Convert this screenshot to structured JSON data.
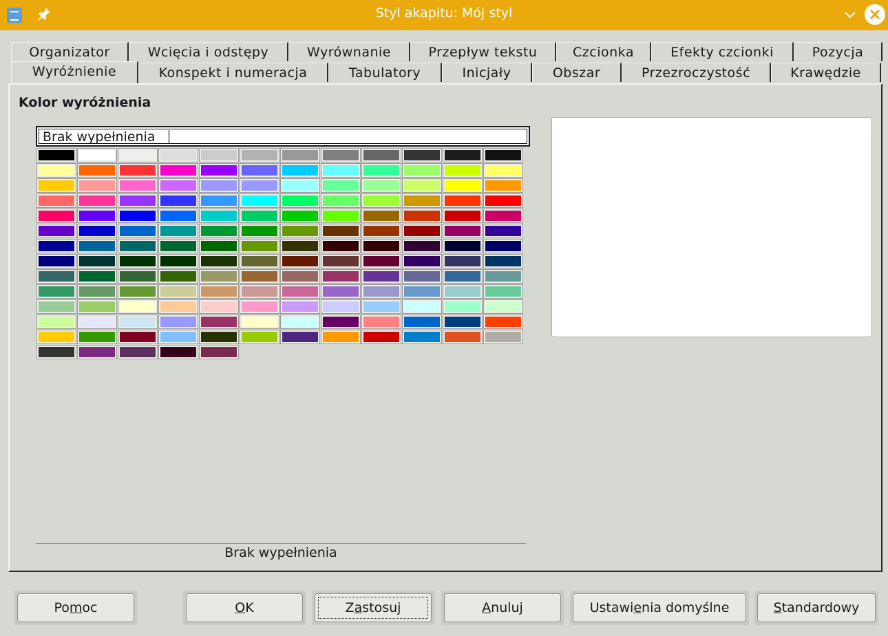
{
  "window": {
    "title": "Styl akapitu: Mój styl",
    "icons": {
      "app": "writer-style-icon",
      "pin": "pin-icon",
      "minimize": "chevron-down-icon",
      "close": "close-icon"
    },
    "accent": "#ebaa0c"
  },
  "tabs": {
    "row1": [
      {
        "label": "Organizator",
        "w": 171
      },
      {
        "label": "Wcięcia i odstępy",
        "w": 232
      },
      {
        "label": "Wyrównanie",
        "w": 177
      },
      {
        "label": "Przepływ tekstu",
        "w": 212
      },
      {
        "label": "Czcionka",
        "w": 138
      },
      {
        "label": "Efekty czcionki",
        "w": 207
      },
      {
        "label": "Pozycja",
        "w": 129
      }
    ],
    "row2": [
      {
        "label": "Wyróżnienie",
        "w": 185,
        "active": true
      },
      {
        "label": "Konspekt i numeracja",
        "w": 276
      },
      {
        "label": "Tabulatory",
        "w": 165
      },
      {
        "label": "Inicjały",
        "w": 131
      },
      {
        "label": "Obszar",
        "w": 130
      },
      {
        "label": "Przezroczystość",
        "w": 217
      },
      {
        "label": "Krawędzie",
        "w": 160
      }
    ]
  },
  "highlight": {
    "section_title": "Kolor wyróżnienia",
    "palette_header": "Brak wypełnienia",
    "selected_name": "Brak wypełnienia",
    "palette_colors": [
      "#000000",
      "#ffffff",
      "#eeeeee",
      "#dddddd",
      "#cccccc",
      "#b2b2b2",
      "#999999",
      "#808080",
      "#666666",
      "#333333",
      "#1c1c1c",
      "#111111",
      "#ffff99",
      "#ff6600",
      "#ff3333",
      "#ff00cc",
      "#9900ff",
      "#6666ff",
      "#00ccff",
      "#66ffff",
      "#33ff99",
      "#99ff66",
      "#ccff00",
      "#ffff66",
      "#ffcc00",
      "#ff9999",
      "#ff66cc",
      "#cc66ff",
      "#9999ff",
      "#9999ff",
      "#99ffff",
      "#66ff99",
      "#99ff99",
      "#ccff66",
      "#ffff00",
      "#ff9900",
      "#ff6666",
      "#ff3399",
      "#9933ff",
      "#3333ff",
      "#3399ff",
      "#00ffff",
      "#00ff66",
      "#66ff66",
      "#99ff33",
      "#cc9900",
      "#ff3300",
      "#ff0000",
      "#ff0066",
      "#6600ff",
      "#0000ff",
      "#0066ff",
      "#00cccc",
      "#00cc66",
      "#00cc00",
      "#66ff00",
      "#996600",
      "#cc3300",
      "#cc0000",
      "#cc0066",
      "#6600cc",
      "#0000cc",
      "#0066cc",
      "#009999",
      "#009933",
      "#009900",
      "#669900",
      "#663300",
      "#993300",
      "#990000",
      "#990066",
      "#330099",
      "#000099",
      "#006699",
      "#006666",
      "#006633",
      "#006600",
      "#669900",
      "#333300",
      "#330000",
      "#330000",
      "#330033",
      "#000033",
      "#000066",
      "#000080",
      "#003333",
      "#003300",
      "#003300",
      "#1a3300",
      "#666633",
      "#661a00",
      "#663333",
      "#660033",
      "#330066",
      "#333366",
      "#003366",
      "#336666",
      "#006633",
      "#336633",
      "#336600",
      "#999966",
      "#996633",
      "#996666",
      "#993366",
      "#663399",
      "#666699",
      "#336699",
      "#669999",
      "#339966",
      "#669966",
      "#669933",
      "#cccc99",
      "#cc9966",
      "#cc9999",
      "#cc6699",
      "#9966cc",
      "#9999cc",
      "#6699cc",
      "#99cccc",
      "#66cc99",
      "#99cc99",
      "#99cc66",
      "#ffffcc",
      "#ffcc99",
      "#ffcccc",
      "#ff99cc",
      "#cc99ff",
      "#ccccff",
      "#99ccff",
      "#ccffff",
      "#99ffcc",
      "#ccffcc",
      "#ccff99",
      "#e6e6ff",
      "#cce6f2",
      "#9999ff",
      "#993366",
      "#ffffcc",
      "#ccffff",
      "#660066",
      "#ff8080",
      "#0066cc",
      "#004080",
      "#ff4000",
      "#ffcc00",
      "#339900",
      "#800020",
      "#80c0ff",
      "#263300",
      "#99cc00",
      "#4d2680",
      "#ff9900",
      "#cc0000",
      "#0080cc",
      "#e05020",
      "#b3aca6",
      "#333333",
      "#7a2a80",
      "#5c2f5c",
      "#33001a",
      "#7a2a4d"
    ]
  },
  "buttons": {
    "help": {
      "pre": "Po",
      "u": "m",
      "post": "oc"
    },
    "ok": {
      "pre": "",
      "u": "O",
      "post": "K"
    },
    "apply": {
      "pre": "Z",
      "u": "a",
      "post": "stosuj"
    },
    "cancel": {
      "pre": "",
      "u": "A",
      "post": "nuluj"
    },
    "defaults": {
      "pre": "Ustawi",
      "u": "e",
      "post": "nia domyślne"
    },
    "standard": {
      "pre": "",
      "u": "S",
      "post": "tandardowy"
    }
  }
}
